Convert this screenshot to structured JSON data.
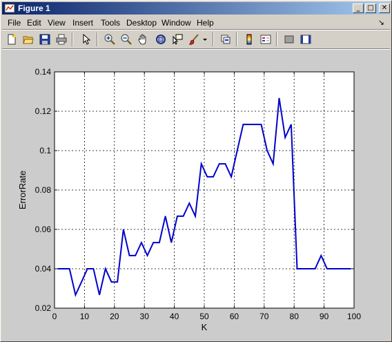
{
  "window": {
    "title": "Figure 1",
    "minimize_glyph": "_",
    "maximize_glyph": "□",
    "close_glyph": "✕"
  },
  "menubar": {
    "items": [
      "File",
      "Edit",
      "View",
      "Insert",
      "Tools",
      "Desktop",
      "Window",
      "Help"
    ],
    "dock_arrow": "↘"
  },
  "toolbar": {
    "icons": [
      "new-figure-icon",
      "open-file-icon",
      "save-icon",
      "print-icon",
      "edit-plot-arrow-icon",
      "zoom-in-icon",
      "zoom-out-icon",
      "pan-hand-icon",
      "rotate-3d-icon",
      "data-cursor-icon",
      "brush-icon",
      "brush-dropdown-icon",
      "link-plot-icon",
      "colorbar-icon",
      "legend-icon",
      "hide-plot-tools-icon",
      "show-plot-tools-icon"
    ]
  },
  "colors": {
    "line": "#0000cc",
    "plot_bg": "#ffffff",
    "figure_bg": "#cccccc",
    "title_gradient_start": "#0a246a",
    "title_gradient_end": "#a6caf0"
  },
  "chart_data": {
    "type": "line",
    "title": "",
    "xlabel": "K",
    "ylabel": "ErrorRate",
    "xlim": [
      0,
      100
    ],
    "ylim": [
      0.02,
      0.14
    ],
    "xticks": [
      "0",
      "10",
      "20",
      "30",
      "40",
      "50",
      "60",
      "70",
      "80",
      "90",
      "100"
    ],
    "yticks": [
      "0.02",
      "0.04",
      "0.06",
      "0.08",
      "0.1",
      "0.12",
      "0.14"
    ],
    "grid": true,
    "series": [
      {
        "x": [
          1,
          3,
          5,
          7,
          9,
          11,
          13,
          15,
          17,
          19,
          21,
          23,
          25,
          27,
          29,
          31,
          33,
          35,
          37,
          39,
          41,
          43,
          45,
          47,
          49,
          51,
          53,
          55,
          57,
          59,
          61,
          63,
          65,
          67,
          69,
          71,
          73,
          75,
          77,
          79,
          81,
          83,
          85,
          87,
          89,
          91,
          93,
          95,
          97,
          99
        ],
        "y": [
          0.04,
          0.04,
          0.04,
          0.0267,
          0.0333,
          0.04,
          0.04,
          0.0267,
          0.04,
          0.0333,
          0.0333,
          0.06,
          0.0467,
          0.0467,
          0.0533,
          0.0467,
          0.0533,
          0.0533,
          0.0667,
          0.0533,
          0.0667,
          0.0667,
          0.0733,
          0.0667,
          0.0933,
          0.0867,
          0.0867,
          0.0933,
          0.0933,
          0.0867,
          0.1,
          0.1133,
          0.1133,
          0.1133,
          0.1133,
          0.1,
          0.0933,
          0.1267,
          0.1067,
          0.1133,
          0.04,
          0.04,
          0.04,
          0.04,
          0.0467,
          0.04,
          0.04,
          0.04,
          0.04,
          0.04
        ]
      }
    ]
  }
}
